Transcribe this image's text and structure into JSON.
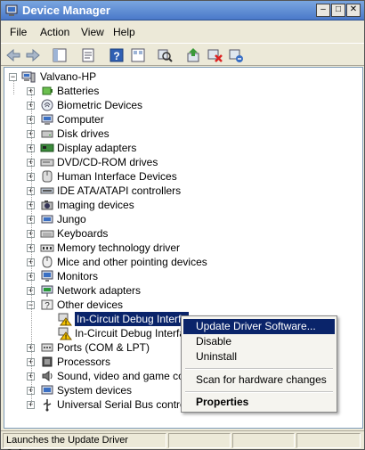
{
  "window": {
    "title": "Device Manager",
    "min_glyph": "–",
    "max_glyph": "□",
    "close_glyph": "✕"
  },
  "menu": {
    "file": "File",
    "action": "Action",
    "view": "View",
    "help": "Help"
  },
  "tree": {
    "root": "Valvano-HP",
    "categories": [
      {
        "label": "Batteries",
        "icon": "battery-icon"
      },
      {
        "label": "Biometric Devices",
        "icon": "fingerprint-icon"
      },
      {
        "label": "Computer",
        "icon": "computer-icon"
      },
      {
        "label": "Disk drives",
        "icon": "disk-drive-icon"
      },
      {
        "label": "Display adapters",
        "icon": "display-adapter-icon"
      },
      {
        "label": "DVD/CD-ROM drives",
        "icon": "dvd-drive-icon"
      },
      {
        "label": "Human Interface Devices",
        "icon": "hid-icon"
      },
      {
        "label": "IDE ATA/ATAPI controllers",
        "icon": "ide-controller-icon"
      },
      {
        "label": "Imaging devices",
        "icon": "camera-icon"
      },
      {
        "label": "Jungo",
        "icon": "jungo-icon"
      },
      {
        "label": "Keyboards",
        "icon": "keyboard-icon"
      },
      {
        "label": "Memory technology driver",
        "icon": "memory-icon"
      },
      {
        "label": "Mice and other pointing devices",
        "icon": "mouse-icon"
      },
      {
        "label": "Monitors",
        "icon": "monitor-icon"
      },
      {
        "label": "Network adapters",
        "icon": "network-adapter-icon"
      },
      {
        "label": "Other devices",
        "icon": "unknown-device-icon"
      }
    ],
    "other_children": [
      {
        "label": "In-Circuit Debug Interfa",
        "icon": "warning-device-icon"
      },
      {
        "label": "In-Circuit Debug Interfa",
        "icon": "warning-device-icon"
      }
    ],
    "after": [
      {
        "label": "Ports (COM & LPT)",
        "icon": "port-icon"
      },
      {
        "label": "Processors",
        "icon": "processor-icon"
      },
      {
        "label": "Sound, video and game cont",
        "icon": "sound-icon"
      },
      {
        "label": "System devices",
        "icon": "system-device-icon"
      },
      {
        "label": "Universal Serial Bus controlle",
        "icon": "usb-icon"
      }
    ]
  },
  "context_menu": {
    "update": "Update Driver Software...",
    "disable": "Disable",
    "uninstall": "Uninstall",
    "scan": "Scan for hardware changes",
    "properties": "Properties"
  },
  "status": {
    "text": "Launches the Update Driver Software"
  },
  "colors": {
    "selection": "#0a246a",
    "title_gradient_top": "#7aa6e0",
    "title_gradient_bottom": "#4a79c9"
  }
}
